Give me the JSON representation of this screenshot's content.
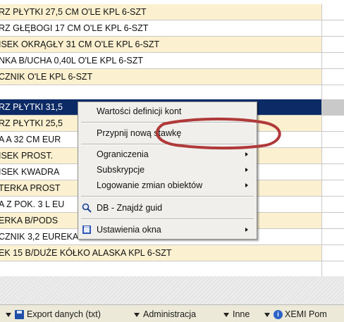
{
  "rows": [
    {
      "text": "RZ PŁYTKI 27,5 CM O'LE KPL 6-SZT",
      "style": "alt"
    },
    {
      "text": "RZ GŁĘBOGI 17 CM O'LE KPL 6-SZT",
      "style": "plain"
    },
    {
      "text": "ISEK OKRĄGŁY 31 CM O'LE KPL 6-SZT",
      "style": "alt"
    },
    {
      "text": "NKA B/UCHA 0,40L O'LE KPL 6-SZT",
      "style": "plain"
    },
    {
      "text": "CZNIK O'LE KPL 6-SZT",
      "style": "alt"
    },
    {
      "text": "RZ PŁYTKI 31,5",
      "style": "selected"
    },
    {
      "text": "RZ PŁYTKI 25,5",
      "style": "alt"
    },
    {
      "text": "A A 32 CM EUR",
      "style": "plain"
    },
    {
      "text": "ISEK PROST.",
      "style": "alt"
    },
    {
      "text": "ISEK KWADRA",
      "style": "plain"
    },
    {
      "text": "TERKA PROST",
      "style": "alt"
    },
    {
      "text": "A Z POK. 3 L EU",
      "style": "plain"
    },
    {
      "text": "ERKA B/PODS",
      "style": "alt"
    },
    {
      "text": "CZNIK 3,2 EUREKA KPL 6-SZT",
      "style": "plain"
    },
    {
      "text": "EK 15 B/DUŻE KÓŁKO ALASKA KPL 6-SZT",
      "style": "alt"
    }
  ],
  "context_menu": {
    "item_definitions": "Wartości definicji kont",
    "item_assign_rate": "Przypnij nową stawkę",
    "item_limits": "Ograniczenia",
    "item_subscriptions": "Subskrypcje",
    "item_change_log": "Logowanie zmian obiektów",
    "item_find_guid": "DB - Znajdź guid",
    "item_window_settings": "Ustawienia okna"
  },
  "toolbar": {
    "export_label": "Export danych (txt)",
    "admin_label": "Administracja",
    "other_label": "Inne",
    "xemi_label": "XEMI Pom"
  },
  "colors": {
    "row_alt": "#fbf0cf",
    "selected_row": "#0c2a66",
    "menu_bg": "#f0efeb",
    "annotation": "#b03a3a"
  }
}
